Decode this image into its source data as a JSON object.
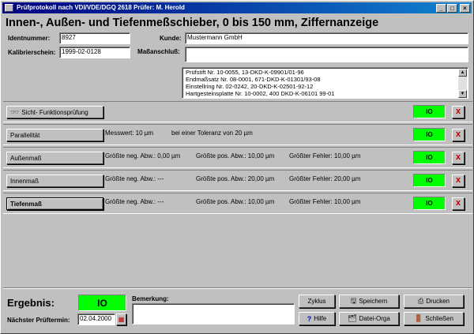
{
  "window": {
    "title": "Prüfprotokoll nach VDI/VDE/DGQ 2618 Prüfer: M. Herold",
    "buttons": {
      "minimize": "_",
      "maximize": "□",
      "close": "×"
    }
  },
  "heading": "Innen-, Außen- und Tiefenmeßschieber, 0 bis 150 mm, Ziffernanzeige",
  "form": {
    "ident_label": "Identnummer:",
    "ident_value": "8927",
    "kalib_label": "Kalibrierschein:",
    "kalib_value": "1999-02-0128",
    "kunde_label": "Kunde:",
    "kunde_value": "Mustermann GmbH",
    "massanschluss_label": "Maßanschluß:",
    "massanschluss_value": ""
  },
  "normals": [
    "Prüfstift Nr. 10-0055, 13-DKD-K-09901/01-96",
    "Endmaßsatz Nr. 08-0001, 671-DKD-K-01301/93-08",
    "Einstellring Nr. 02-0242, 20-DKD-K-02501-92-12",
    "Hartgesteinsplatte Nr. 10-0002, 400 DKD-K-06101 99-01"
  ],
  "rows": [
    {
      "button": "Sicht- Funktionsprüfung",
      "c1": "",
      "c2": "",
      "c3": "",
      "result": "IO",
      "delete": "x"
    },
    {
      "button": "Parallelität",
      "c1": "Messwert: 10 µm",
      "c2": "bei einer Toleranz von 20 µm",
      "c3": "",
      "result": "IO",
      "delete": "x"
    },
    {
      "button": "Außenmaß",
      "c1": "Größte neg. Abw.: 0,00 µm",
      "c2": "Größte pos. Abw.: 10,00 µm",
      "c3": "Größter Fehler: 10,00 µm",
      "result": "IO",
      "delete": "x"
    },
    {
      "button": "Innenmaß",
      "c1": "Größte neg. Abw.: ---",
      "c2": "Größte pos. Abw.: 20,00 µm",
      "c3": "Größter Fehler: 20,00 µm",
      "result": "IO",
      "delete": "x"
    },
    {
      "button": "Tiefenmaß",
      "c1": "Größte neg. Abw.: ---",
      "c2": "Größte pos. Abw.: 10,00 µm",
      "c3": "Größter Fehler: 10,00 µm",
      "result": "IO",
      "delete": "x"
    }
  ],
  "footer": {
    "ergebnis_label": "Ergebnis:",
    "ergebnis_value": "IO",
    "pruftermin_label": "Nächster Prüftermin:",
    "pruftermin_value": "02.04.2000",
    "bemerkung_label": "Bemerkung:",
    "bemerkung_value": "",
    "buttons": {
      "zyklus": "Zyklus",
      "speichern": "Speichern",
      "drucken": "Drucken",
      "hilfe": "Hilfe",
      "datei_orga": "Datei-Orga",
      "schliessen": "Schließen"
    }
  },
  "colors": {
    "ok": "#00ff00",
    "delete": "#c00000",
    "titlebar": "#000080"
  }
}
